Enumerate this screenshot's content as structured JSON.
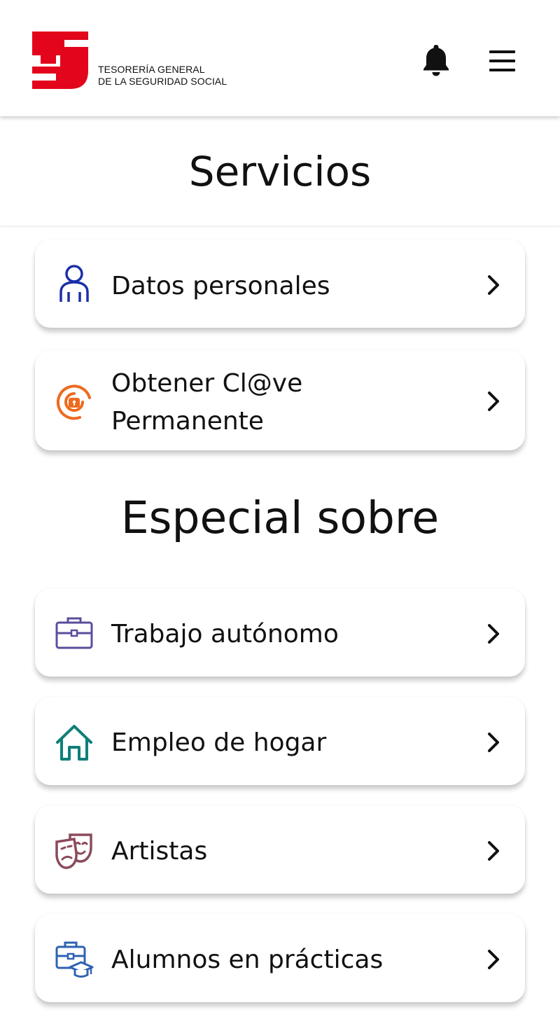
{
  "header": {
    "logo_line1": "TESORERÍA GENERAL",
    "logo_line2": "DE LA SEGURIDAD SOCIAL",
    "notifications_icon": "bell-icon",
    "menu_icon": "hamburger-menu-icon"
  },
  "page": {
    "title": "Servicios"
  },
  "services": [
    {
      "label": "Datos personales",
      "icon": "person-icon",
      "icon_color": "#1b2fa8"
    },
    {
      "label_line1": "Obtener Cl@ve",
      "label_line2": "Permanente",
      "icon": "clave-at-icon",
      "icon_color": "#ee6a1f"
    }
  ],
  "special": {
    "title": "Especial sobre",
    "items": [
      {
        "label": "Trabajo autónomo",
        "icon": "briefcase-icon",
        "icon_color": "#5a4e9c"
      },
      {
        "label": "Empleo de hogar",
        "icon": "house-icon",
        "icon_color": "#0f7f7a"
      },
      {
        "label": "Artistas",
        "icon": "theater-masks-icon",
        "icon_color": "#8b4a5a"
      },
      {
        "label": "Alumnos en prácticas",
        "icon": "student-briefcase-icon",
        "icon_color": "#2f62b0"
      }
    ]
  },
  "colors": {
    "brand_red": "#e3051b",
    "text": "#111111"
  }
}
